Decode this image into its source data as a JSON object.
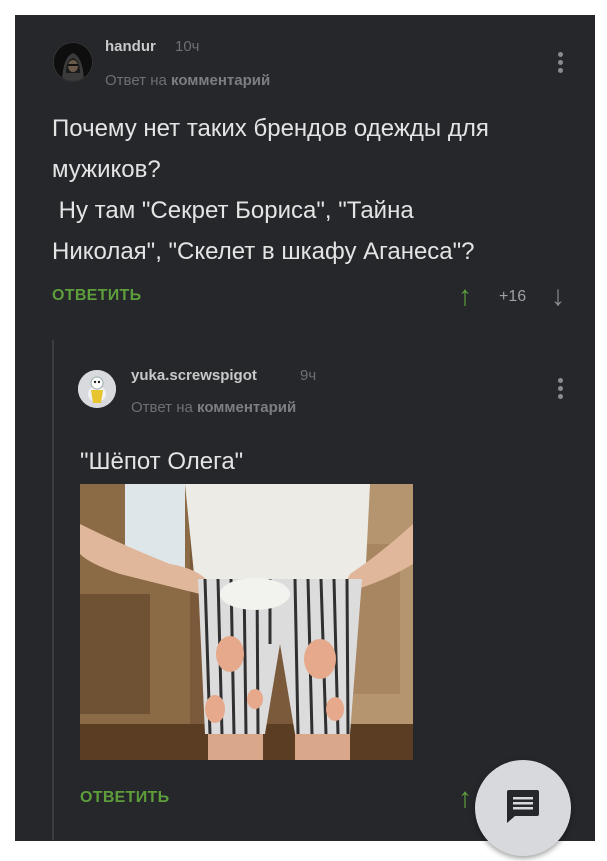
{
  "comments": [
    {
      "username": "handur",
      "time": "10ч",
      "reply_prefix": "Ответ на",
      "reply_target": "комментарий",
      "text": "Почему нет таких брендов одежды для\nмужиков?\n Ну там \"Секрет Бориса\", \"Тайна\nНиколая\", \"Скелет в шкафу Аганеса\"?",
      "reply_label": "ОТВЕТИТЬ",
      "score": "+16"
    },
    {
      "username": "yuka.screwspigot",
      "time": "9ч",
      "reply_prefix": "Ответ на",
      "reply_target": "комментарий",
      "text": "\"Шёпот Олега\"",
      "reply_label": "ОТВЕТИТЬ"
    }
  ],
  "icons": {
    "more": "more-vertical-icon",
    "upvote": "arrow-up-icon",
    "downvote": "arrow-down-icon",
    "fab": "comments-icon"
  },
  "colors": {
    "background": "#25272b",
    "accent_green": "#5d9e3b",
    "text": "#e4e4e4",
    "muted": "#6d6f73"
  }
}
